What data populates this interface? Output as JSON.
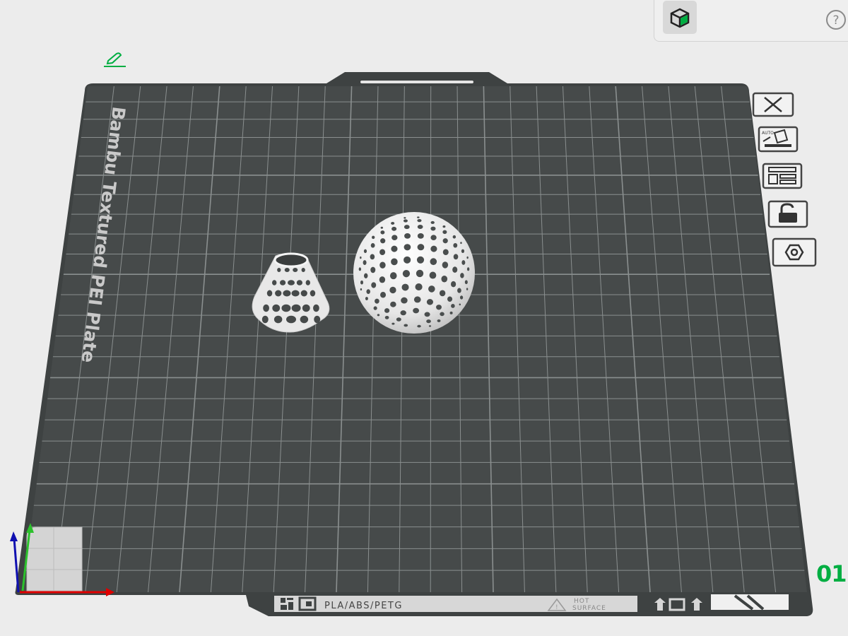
{
  "toolbar": {
    "object_tool_icon": "cube-icon",
    "help_icon": "question-icon",
    "help_label": "?"
  },
  "edit_icon": "edit-pencil-icon",
  "plate": {
    "name": "Bambu Textured PEI Plate",
    "material_label": "PLA/ABS/PETG",
    "warning_line1": "HOT",
    "warning_line2": "SURFACE",
    "number": "01"
  },
  "side_tools": [
    {
      "icon": "close-icon"
    },
    {
      "icon": "auto-orient-icon",
      "label": "AUTO"
    },
    {
      "icon": "arrange-icon"
    },
    {
      "icon": "lock-icon"
    },
    {
      "icon": "plate-settings-icon"
    }
  ],
  "colors": {
    "accent": "#00ae42",
    "plate": "#464a4a",
    "grid": "#8a8f8f",
    "background": "#ececec",
    "axis_x": "#e00000",
    "axis_y": "#2cc12c",
    "axis_z": "#1010b0"
  },
  "objects": [
    {
      "name": "perforated-cone"
    },
    {
      "name": "perforated-sphere"
    }
  ]
}
